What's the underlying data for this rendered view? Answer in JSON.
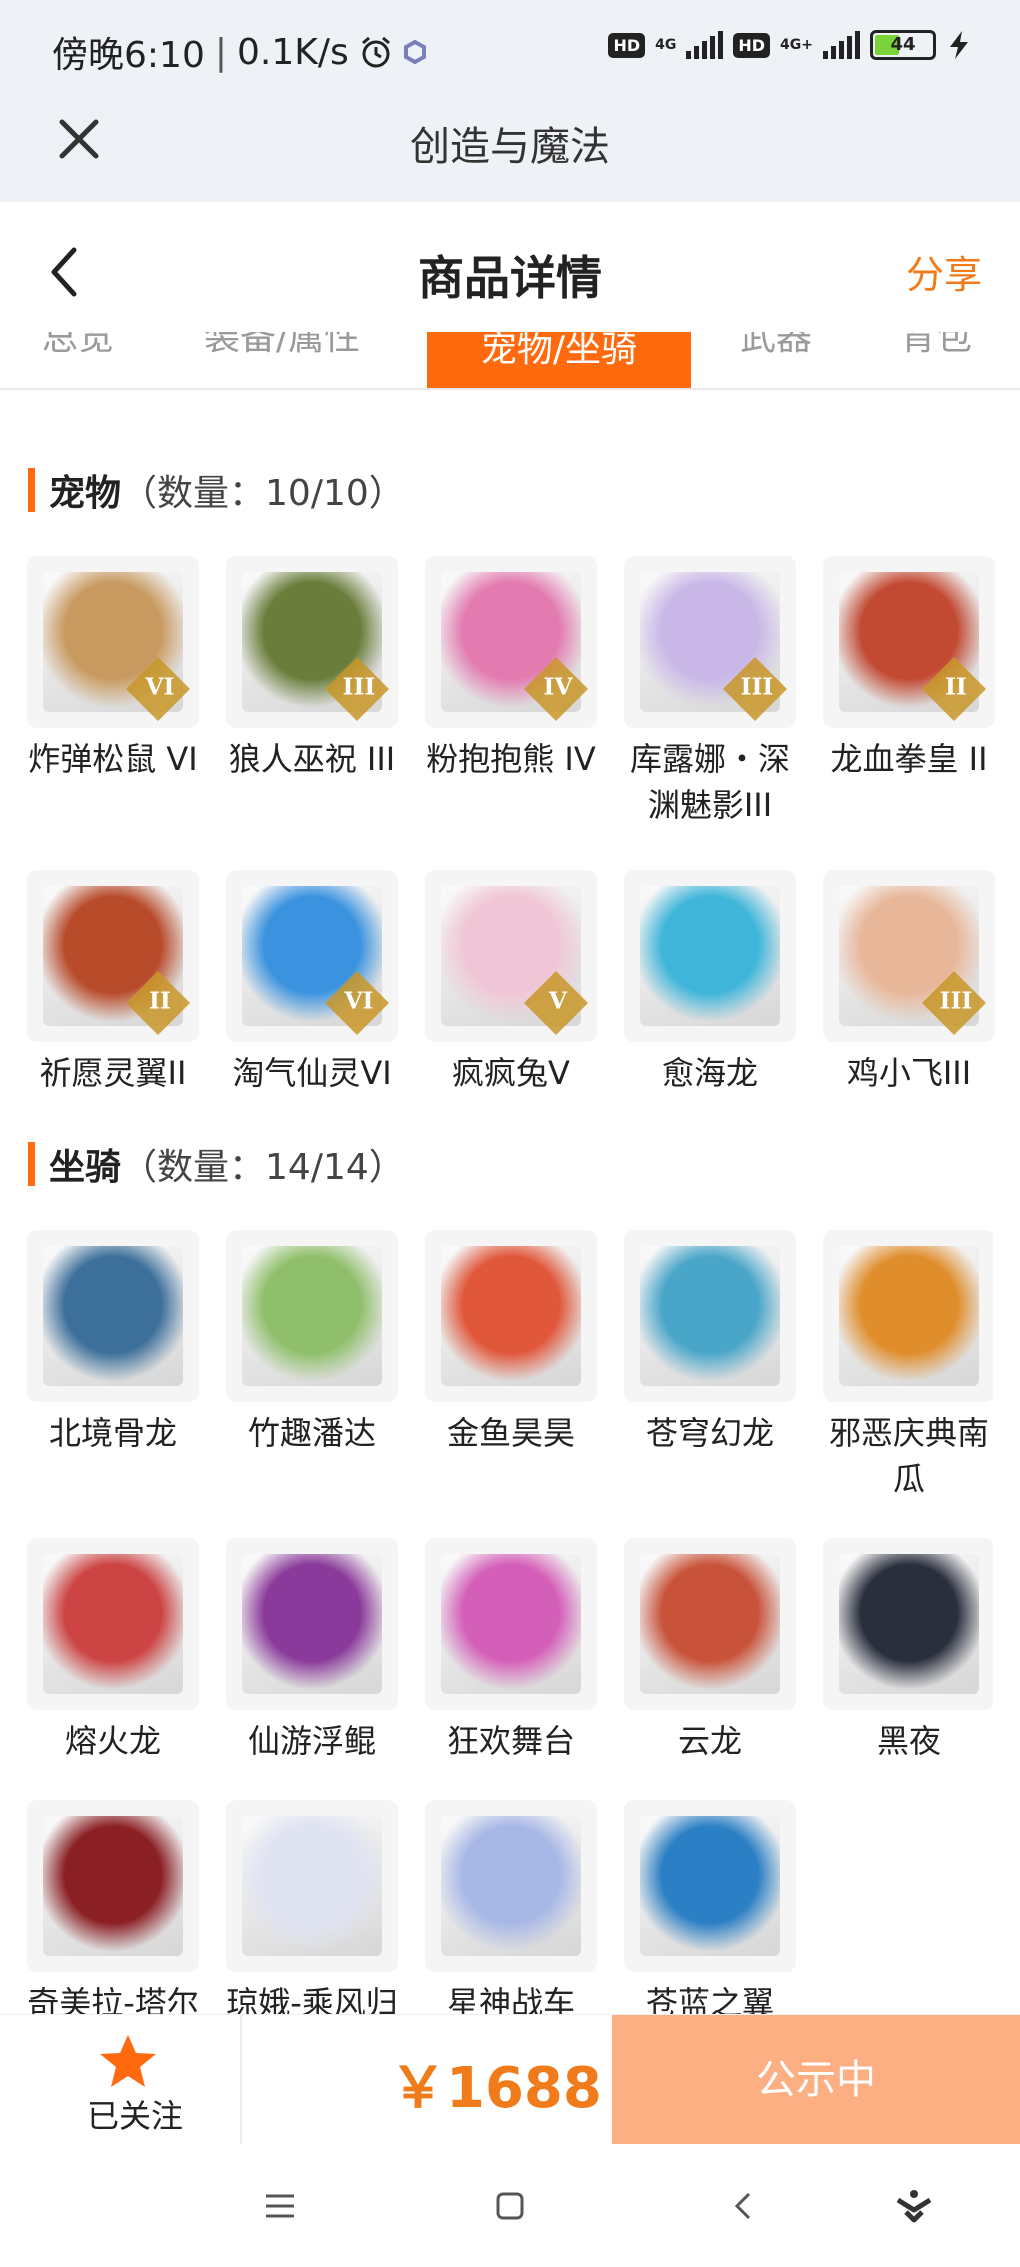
{
  "status_bar": {
    "time": "傍晚6:10",
    "speed": "0.1K/s",
    "hd1": "HD",
    "net1": "4G",
    "hd2": "HD",
    "net2": "4G+",
    "battery": "44"
  },
  "app_bar": {
    "title": "创造与魔法"
  },
  "header": {
    "title": "商品详情",
    "share": "分享"
  },
  "tabs": [
    {
      "label": "总览",
      "active": false
    },
    {
      "label": "装备/属性",
      "active": false
    },
    {
      "label": "宠物/坐骑",
      "active": true
    },
    {
      "label": "武器",
      "active": false
    },
    {
      "label": "背包",
      "active": false
    }
  ],
  "pets": {
    "title": "宠物",
    "count": "（数量：10/10）",
    "items": [
      {
        "name": "炸弹松鼠 VI",
        "badge": "VI",
        "color": "#c89a60"
      },
      {
        "name": "狼人巫祝 III",
        "badge": "III",
        "color": "#6a7d3a"
      },
      {
        "name": "粉抱抱熊 IV",
        "badge": "IV",
        "color": "#e37ab0"
      },
      {
        "name": "库露娜・深渊魅影III",
        "badge": "III",
        "color": "#c9b7e8"
      },
      {
        "name": "龙血拳皇 II",
        "badge": "II",
        "color": "#c24a33"
      },
      {
        "name": "祈愿灵翼II",
        "badge": "II",
        "color": "#b84b2a"
      },
      {
        "name": "淘气仙灵VI",
        "badge": "VI",
        "color": "#3b93e0"
      },
      {
        "name": "疯疯兔V",
        "badge": "V",
        "color": "#f0c6d6"
      },
      {
        "name": "愈海龙",
        "badge": "",
        "color": "#3fb5d9"
      },
      {
        "name": "鸡小飞III",
        "badge": "III",
        "color": "#e8b79a"
      }
    ]
  },
  "mounts": {
    "title": "坐骑",
    "count": "（数量：14/14）",
    "items": [
      {
        "name": "北境骨龙",
        "color": "#3c6f9a"
      },
      {
        "name": "竹趣潘达",
        "color": "#8fbf6a"
      },
      {
        "name": "金鱼昊昊",
        "color": "#e0573a"
      },
      {
        "name": "苍穹幻龙",
        "color": "#4aa6c9"
      },
      {
        "name": "邪恶庆典南瓜",
        "color": "#e08d2c"
      },
      {
        "name": "熔火龙",
        "color": "#cc4444"
      },
      {
        "name": "仙游浮鲲",
        "color": "#8a3a9a"
      },
      {
        "name": "狂欢舞台",
        "color": "#d45fb8"
      },
      {
        "name": "云龙",
        "color": "#c9533a"
      },
      {
        "name": "黑夜",
        "color": "#2a2f3e"
      },
      {
        "name": "奇美拉-塔尔诺斯",
        "color": "#8a1f24"
      },
      {
        "name": "琼娥-乘风归",
        "color": "#dfe3f2"
      },
      {
        "name": "星神战车",
        "color": "#a7b7e6"
      },
      {
        "name": "苍蓝之翼",
        "color": "#2b7fc4"
      }
    ]
  },
  "bottom": {
    "follow": "已关注",
    "price": "￥1688",
    "status": "公示中"
  },
  "colors": {
    "accent": "#ff6a0f",
    "price": "#f07b1a",
    "status_button": "#fdaf84"
  }
}
